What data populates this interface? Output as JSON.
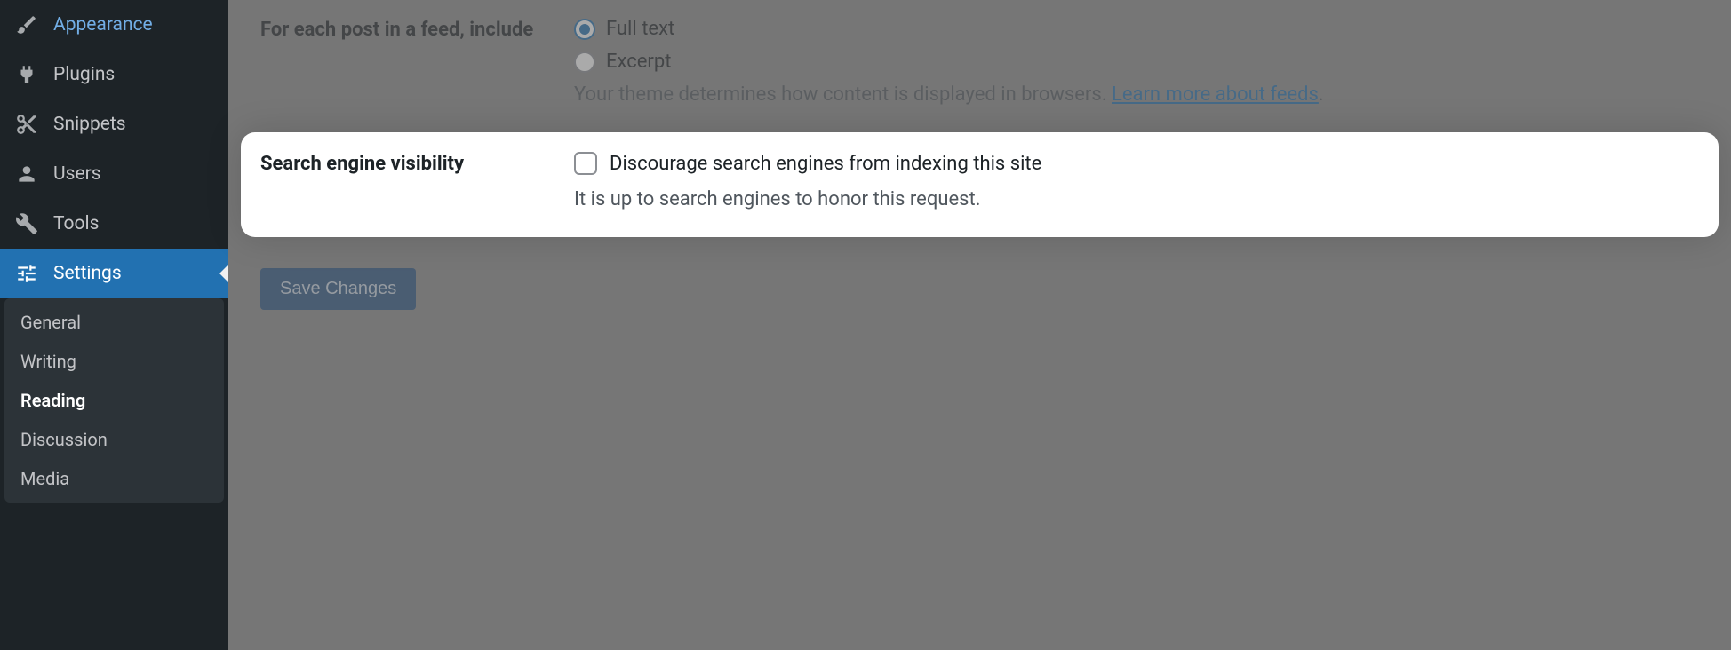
{
  "sidebar": {
    "items": [
      {
        "label": "Appearance"
      },
      {
        "label": "Plugins"
      },
      {
        "label": "Snippets"
      },
      {
        "label": "Users"
      },
      {
        "label": "Tools"
      },
      {
        "label": "Settings"
      }
    ],
    "submenu": [
      {
        "label": "General"
      },
      {
        "label": "Writing"
      },
      {
        "label": "Reading"
      },
      {
        "label": "Discussion"
      },
      {
        "label": "Media"
      }
    ]
  },
  "content": {
    "feed_section": {
      "label": "For each post in a feed, include",
      "options": {
        "full_text": "Full text",
        "excerpt": "Excerpt"
      },
      "description": "Your theme determines how content is displayed in browsers. ",
      "link_text": "Learn more about feeds",
      "period": "."
    },
    "seo_section": {
      "label": "Search engine visibility",
      "checkbox_label": "Discourage search engines from indexing this site",
      "description": "It is up to search engines to honor this request."
    },
    "save_button": "Save Changes"
  }
}
